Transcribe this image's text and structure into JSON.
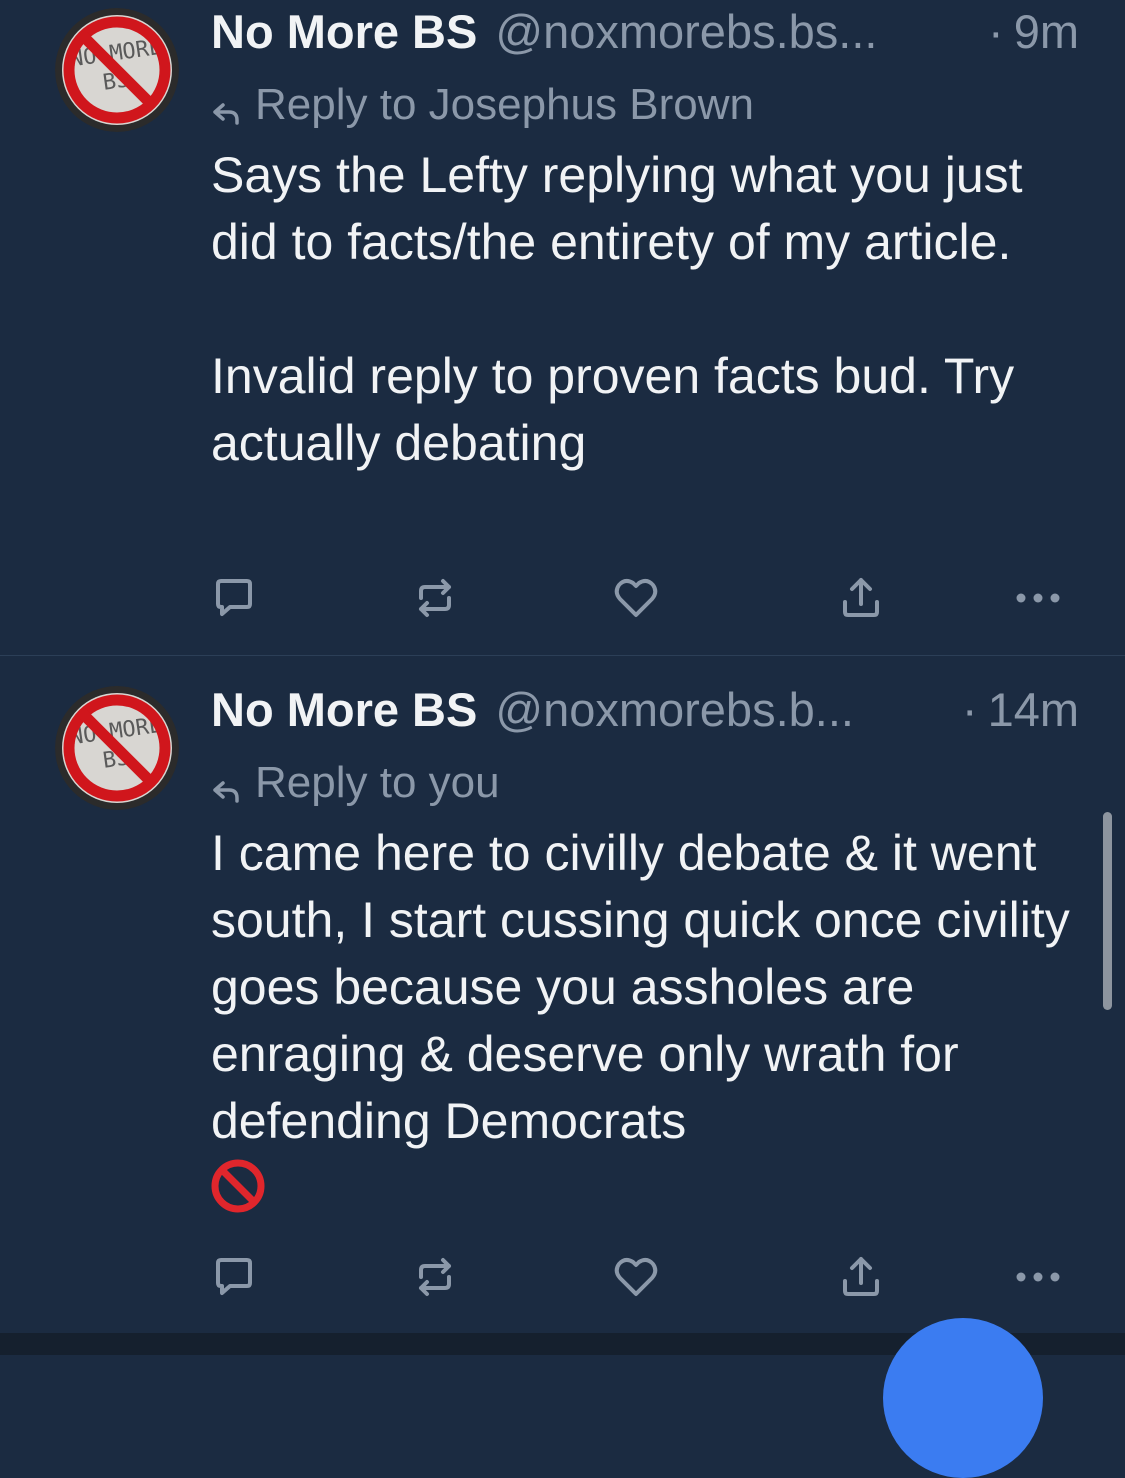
{
  "colors": {
    "background": "#1b2b41",
    "text_primary": "#f1f3f5",
    "text_secondary": "#8b98a9",
    "fab_blue": "#3b7cf1"
  },
  "posts": [
    {
      "display_name": "No More BS",
      "handle": "@noxmorebs.bs...",
      "separator": "·",
      "time": "9m",
      "reply_prefix": "Reply to",
      "reply_to": "Josephus Brown",
      "text": "Says the Lefty replying what you just did to facts/the entirety of my article.\n\nInvalid reply to proven facts bud. Try actually debating",
      "emoji": "",
      "actions": [
        "reply-icon",
        "repost-icon",
        "like-icon",
        "share-icon",
        "more-icon"
      ]
    },
    {
      "display_name": "No More BS",
      "handle": "@noxmorebs.b...",
      "separator": "·",
      "time": "14m",
      "reply_prefix": "Reply to",
      "reply_to": "you",
      "text": "I came here to civilly debate & it went south, I start cussing quick once civility goes because you assholes are enraging & deserve only wrath for defending Democrats\n",
      "emoji": "🚫",
      "actions": [
        "reply-icon",
        "repost-icon",
        "like-icon",
        "share-icon",
        "more-icon"
      ]
    }
  ],
  "avatar_logo_text": "NO MORE BS"
}
